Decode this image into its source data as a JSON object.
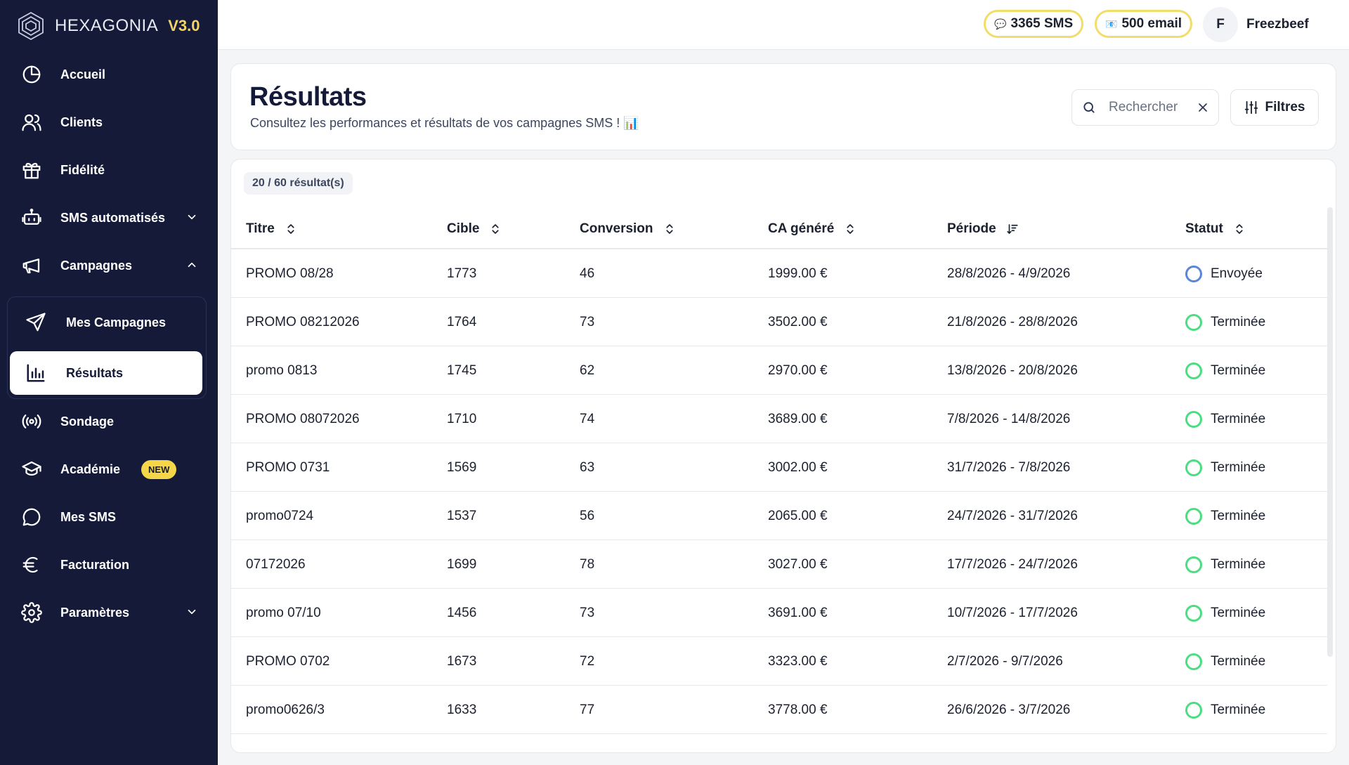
{
  "brand": {
    "name": "HEXAGONIA",
    "version": "V3.0"
  },
  "sidebar": {
    "items": [
      {
        "label": "Accueil",
        "icon": "pie-chart-icon"
      },
      {
        "label": "Clients",
        "icon": "users-icon"
      },
      {
        "label": "Fidélité",
        "icon": "gift-icon"
      },
      {
        "label": "SMS automatisés",
        "icon": "robot-icon",
        "expandable": true,
        "expanded": false
      },
      {
        "label": "Campagnes",
        "icon": "megaphone-icon",
        "expandable": true,
        "expanded": true
      },
      {
        "label": "Sondage",
        "icon": "broadcast-icon"
      },
      {
        "label": "Académie",
        "icon": "graduation-cap-icon",
        "badge": "NEW"
      },
      {
        "label": "Mes SMS",
        "icon": "chat-bubble-icon"
      },
      {
        "label": "Facturation",
        "icon": "euro-icon"
      },
      {
        "label": "Paramètres",
        "icon": "gear-icon",
        "expandable": true,
        "expanded": false
      }
    ],
    "campaign_sub": [
      {
        "label": "Mes Campagnes",
        "icon": "send-icon",
        "active": false
      },
      {
        "label": "Résultats",
        "icon": "bar-chart-icon",
        "active": true
      }
    ]
  },
  "topbar": {
    "sms_credits": "3365 SMS",
    "email_credits": "500 email",
    "avatar_initial": "F",
    "username": "Freezbeef"
  },
  "header": {
    "title": "Résultats",
    "subtitle": "Consultez les performances et résultats de vos campagnes SMS ! 📊",
    "search_placeholder": "Rechercher",
    "filters_label": "Filtres"
  },
  "table": {
    "count": "20 / 60 résultat(s)",
    "columns": [
      "Titre",
      "Cible",
      "Conversion",
      "CA généré",
      "Période",
      "Statut"
    ],
    "rows": [
      {
        "titre": "PROMO 08/28",
        "cible": "1773",
        "conversion": "46",
        "ca": "1999.00 €",
        "periode": "28/8/2026 - 4/9/2026",
        "statut": "Envoyée"
      },
      {
        "titre": "PROMO 08212026",
        "cible": "1764",
        "conversion": "73",
        "ca": "3502.00 €",
        "periode": "21/8/2026 - 28/8/2026",
        "statut": "Terminée"
      },
      {
        "titre": "promo 0813",
        "cible": "1745",
        "conversion": "62",
        "ca": "2970.00 €",
        "periode": "13/8/2026 - 20/8/2026",
        "statut": "Terminée"
      },
      {
        "titre": "PROMO 08072026",
        "cible": "1710",
        "conversion": "74",
        "ca": "3689.00 €",
        "periode": "7/8/2026 - 14/8/2026",
        "statut": "Terminée"
      },
      {
        "titre": "PROMO 0731",
        "cible": "1569",
        "conversion": "63",
        "ca": "3002.00 €",
        "periode": "31/7/2026 - 7/8/2026",
        "statut": "Terminée"
      },
      {
        "titre": "promo0724",
        "cible": "1537",
        "conversion": "56",
        "ca": "2065.00 €",
        "periode": "24/7/2026 - 31/7/2026",
        "statut": "Terminée"
      },
      {
        "titre": "07172026",
        "cible": "1699",
        "conversion": "78",
        "ca": "3027.00 €",
        "periode": "17/7/2026 - 24/7/2026",
        "statut": "Terminée"
      },
      {
        "titre": "promo 07/10",
        "cible": "1456",
        "conversion": "73",
        "ca": "3691.00 €",
        "periode": "10/7/2026 - 17/7/2026",
        "statut": "Terminée"
      },
      {
        "titre": "PROMO 0702",
        "cible": "1673",
        "conversion": "72",
        "ca": "3323.00 €",
        "periode": "2/7/2026 - 9/7/2026",
        "statut": "Terminée"
      },
      {
        "titre": "promo0626/3",
        "cible": "1633",
        "conversion": "77",
        "ca": "3778.00 €",
        "periode": "26/6/2026 - 3/7/2026",
        "statut": "Terminée"
      }
    ]
  },
  "colors": {
    "sidebar_bg": "#141a38",
    "accent_yellow": "#f5d648",
    "status_done": "#4ade80",
    "status_sent": "#5b86d6"
  }
}
